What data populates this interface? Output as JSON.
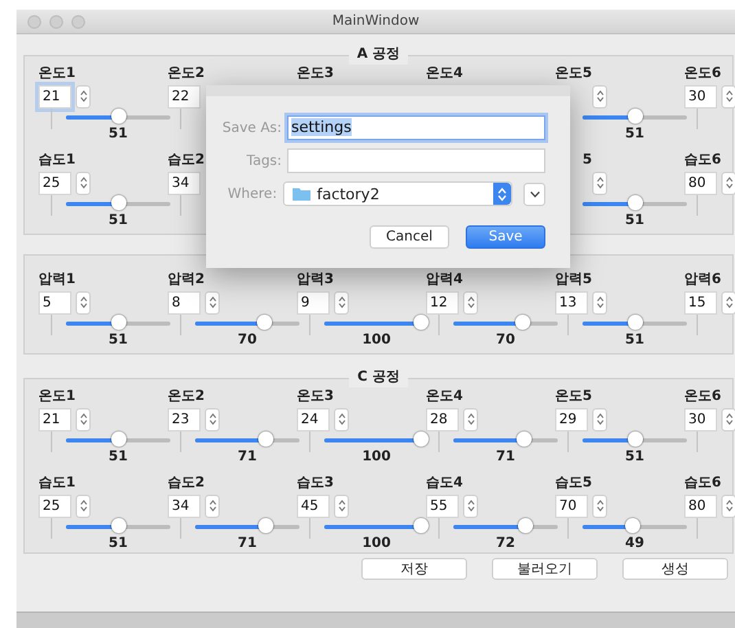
{
  "window": {
    "title": "MainWindow"
  },
  "groups": [
    {
      "title": "A 공정",
      "rows": [
        {
          "columns": [
            {
              "label": "온도1",
              "value": "21",
              "focused": true,
              "slider": {
                "level": 0.51,
                "reading": "51"
              }
            },
            {
              "label": "온도2",
              "value": "22",
              "focused": false
            },
            {
              "label": "온도3"
            },
            {
              "label": "온도4"
            },
            {
              "label": "온도5",
              "slider": {
                "level": 0.51,
                "reading": "51"
              }
            },
            {
              "label": "온도6",
              "value": "30",
              "focused": false
            }
          ]
        },
        {
          "columns": [
            {
              "label": "습도1",
              "value": "25",
              "focused": false,
              "slider": {
                "level": 0.51,
                "reading": "51"
              }
            },
            {
              "label": "습도2",
              "value": "34",
              "focused": false
            },
            {},
            {},
            {
              "label": "5",
              "slider": {
                "level": 0.51,
                "reading": "51"
              }
            },
            {
              "label": "습도6",
              "value": "80",
              "focused": false
            }
          ]
        }
      ]
    },
    {
      "rows": [
        {
          "columns": [
            {
              "label": "압력1",
              "value": "5",
              "focused": false,
              "slider": {
                "level": 0.51,
                "reading": "51"
              }
            },
            {
              "label": "압력2",
              "value": "8",
              "focused": false,
              "slider": {
                "level": 0.7,
                "reading": "70"
              }
            },
            {
              "label": "압력3",
              "value": "9",
              "focused": false,
              "slider": {
                "level": 1,
                "reading": "100"
              }
            },
            {
              "label": "압력4",
              "value": "12",
              "focused": false,
              "slider": {
                "level": 0.7,
                "reading": "70"
              }
            },
            {
              "label": "압력5",
              "value": "13",
              "focused": false,
              "slider": {
                "level": 0.51,
                "reading": "51"
              }
            },
            {
              "label": "압력6",
              "value": "15",
              "focused": false
            }
          ]
        }
      ]
    },
    {
      "title": "C 공정",
      "rows": [
        {
          "columns": [
            {
              "label": "온도1",
              "value": "21",
              "focused": false,
              "slider": {
                "level": 0.51,
                "reading": "51"
              }
            },
            {
              "label": "온도2",
              "value": "23",
              "focused": false,
              "slider": {
                "level": 0.71,
                "reading": "71"
              }
            },
            {
              "label": "온도3",
              "value": "24",
              "focused": false,
              "slider": {
                "level": 1,
                "reading": "100"
              }
            },
            {
              "label": "온도4",
              "value": "28",
              "focused": false,
              "slider": {
                "level": 0.71,
                "reading": "71"
              }
            },
            {
              "label": "온도5",
              "value": "29",
              "focused": false,
              "slider": {
                "level": 0.51,
                "reading": "51"
              }
            },
            {
              "label": "온도6",
              "value": "30",
              "focused": false
            }
          ]
        },
        {
          "columns": [
            {
              "label": "습도1",
              "value": "25",
              "focused": false,
              "slider": {
                "level": 0.51,
                "reading": "51"
              }
            },
            {
              "label": "습도2",
              "value": "34",
              "focused": false,
              "slider": {
                "level": 0.71,
                "reading": "71"
              }
            },
            {
              "label": "습도3",
              "value": "45",
              "focused": false,
              "slider": {
                "level": 1,
                "reading": "100"
              }
            },
            {
              "label": "습도4",
              "value": "55",
              "focused": false,
              "slider": {
                "level": 0.72,
                "reading": "72"
              }
            },
            {
              "label": "습도5",
              "value": "70",
              "focused": false,
              "slider": {
                "level": 0.49,
                "reading": "49"
              }
            },
            {
              "label": "습도6",
              "value": "80",
              "focused": false
            }
          ]
        }
      ]
    }
  ],
  "buttons": [
    "저장",
    "불러오기",
    "생성"
  ],
  "dialog": {
    "fields": [
      {
        "kind": "text",
        "label": "Save As:",
        "value": "settings",
        "focused": true
      },
      {
        "kind": "text",
        "label": "Tags:",
        "focused": false
      },
      {
        "kind": "popup",
        "label": "Where:",
        "value": "factory2"
      }
    ],
    "buttons": [
      {
        "label": "Cancel",
        "default": false
      },
      {
        "label": "Save",
        "default": true
      }
    ]
  }
}
